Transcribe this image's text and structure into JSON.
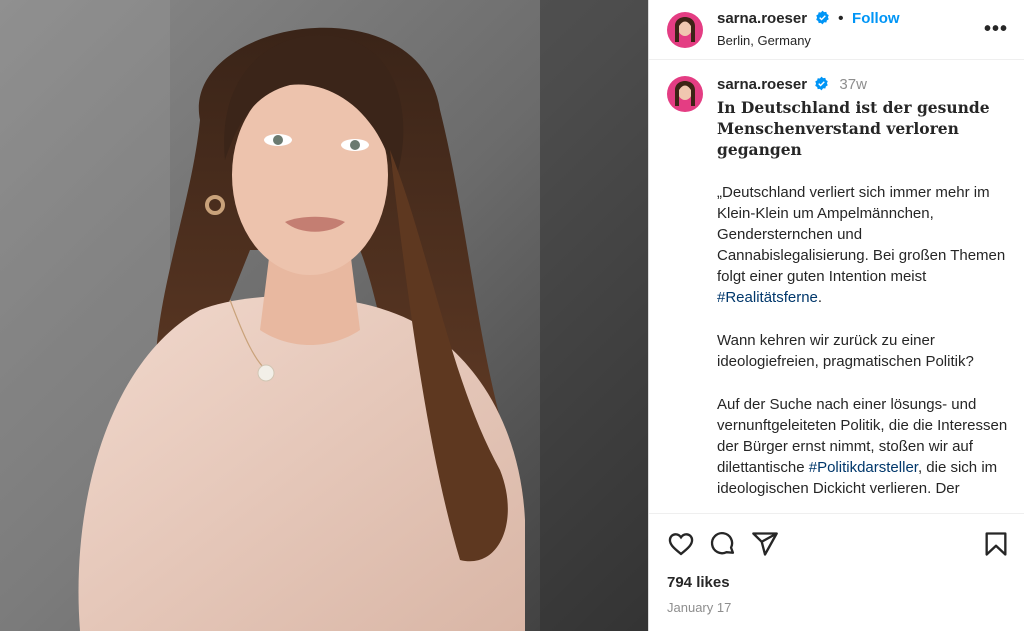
{
  "post": {
    "username": "sarna.roeser",
    "follow_label": "Follow",
    "location": "Berlin, Germany",
    "more_label": "•••"
  },
  "caption": {
    "username": "sarna.roeser",
    "time": "37w",
    "title": "In Deutschland ist der gesunde Menschenverstand verloren gegangen",
    "p1_text": "„Deutschland verliert sich immer mehr im Klein-Klein um Ampelmännchen, Gendersternchen und Cannabislegalisierung. Bei großen Themen folgt einer guten Intention meist ",
    "p1_tag": "#Realitätsferne",
    "p1_end": ".",
    "p2": "Wann kehren wir zurück zu einer ideologiefreien, pragmatischen Politik?",
    "p3_text": "Auf der Suche nach einer lösungs- und vernunftgeleiteten Politik, die die Interessen der Bürger ernst nimmt, stoßen wir auf dilettantische ",
    "p3_tag": "#Politikdarsteller",
    "p3_end": ", die sich im ideologischen Dickicht verlieren. Der"
  },
  "stats": {
    "likes": "794 likes",
    "date": "January 17"
  },
  "icons": [
    "heart-icon",
    "comment-icon",
    "share-icon",
    "save-icon",
    "verified-icon"
  ],
  "colors": {
    "accent": "#0095f6",
    "hashtag": "#00376b",
    "muted": "#8e8e8e"
  }
}
